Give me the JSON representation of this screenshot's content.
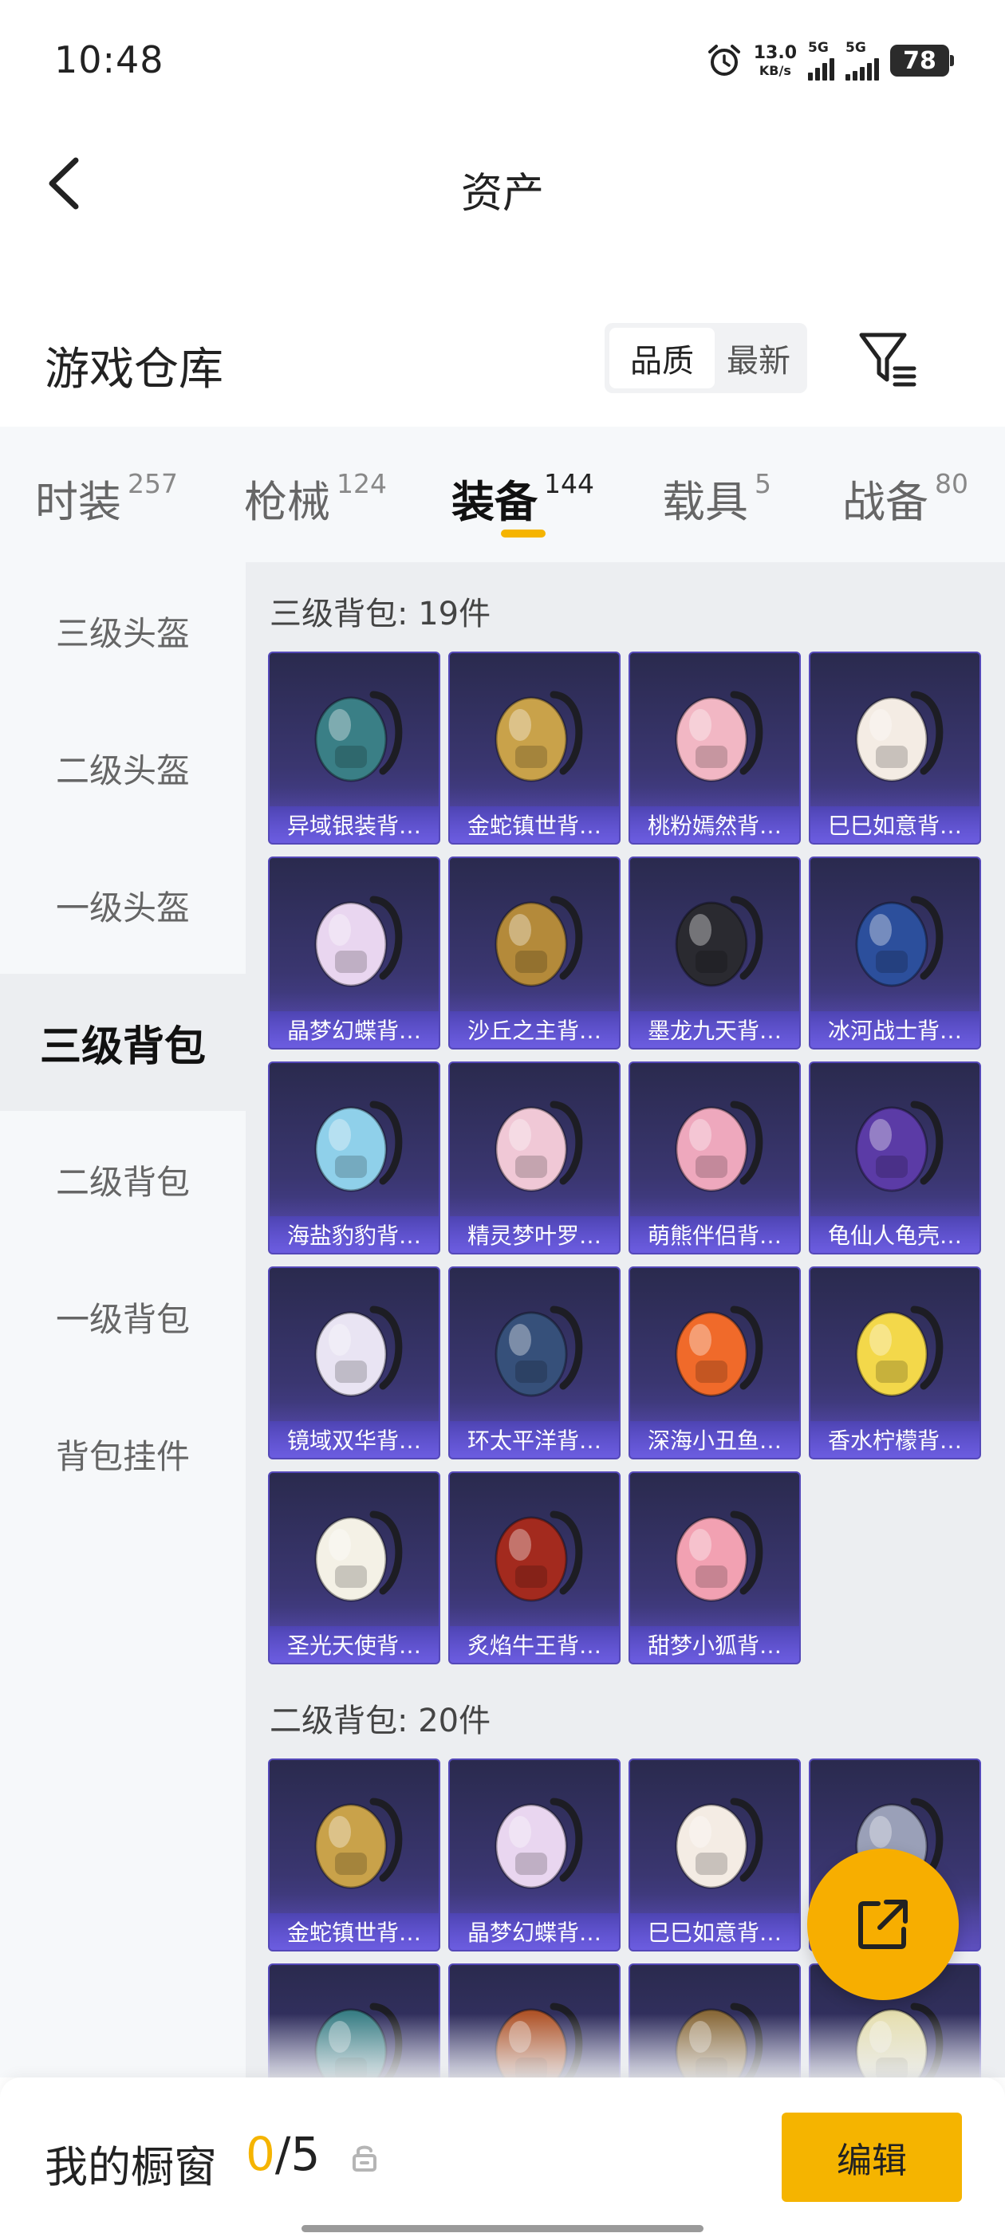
{
  "status_bar": {
    "time": "10:48",
    "net_speed_value": "13.0",
    "net_speed_unit": "KB/s",
    "sim1_type": "5G",
    "sim2_type": "5G",
    "battery": "78",
    "icons": [
      "alarm-icon",
      "signal-icon",
      "signal-icon",
      "battery-icon"
    ]
  },
  "header": {
    "title": "资产",
    "back_icon": "chevron-left-icon"
  },
  "warehouse": {
    "title": "游戏仓库",
    "sort_options": [
      "品质",
      "最新"
    ],
    "sort_selected": "品质",
    "filter_icon": "filter-icon"
  },
  "tabs": [
    {
      "label": "时装",
      "count": "257"
    },
    {
      "label": "枪械",
      "count": "124"
    },
    {
      "label": "装备",
      "count": "144"
    },
    {
      "label": "载具",
      "count": "5"
    },
    {
      "label": "战备",
      "count": "80"
    }
  ],
  "active_tab": "装备",
  "sidebar": {
    "items": [
      "三级头盔",
      "二级头盔",
      "一级头盔",
      "三级背包",
      "二级背包",
      "一级背包",
      "背包挂件"
    ],
    "active": "三级背包"
  },
  "sections": [
    {
      "title": "三级背包: 19件",
      "items": [
        {
          "name": "异域银装背…",
          "color": "#3a7f86"
        },
        {
          "name": "金蛇镇世背…",
          "color": "#c9a24a"
        },
        {
          "name": "桃粉嫣然背…",
          "color": "#f2b7c4"
        },
        {
          "name": "巳巳如意背…",
          "color": "#f4ece4"
        },
        {
          "name": "晶梦幻蝶背…",
          "color": "#e9d6f0"
        },
        {
          "name": "沙丘之主背…",
          "color": "#b48a3a"
        },
        {
          "name": "墨龙九天背…",
          "color": "#2a2a30"
        },
        {
          "name": "冰河战士背…",
          "color": "#2c4f9c"
        },
        {
          "name": "海盐豹豹背…",
          "color": "#8fd0ea"
        },
        {
          "name": "精灵梦叶罗…",
          "color": "#f0c8d6"
        },
        {
          "name": "萌熊伴侣背…",
          "color": "#eea8bd"
        },
        {
          "name": "龟仙人龟壳…",
          "color": "#5b3ba6"
        },
        {
          "name": "镜域双华背…",
          "color": "#e9e4f3"
        },
        {
          "name": "环太平洋背…",
          "color": "#36507a"
        },
        {
          "name": "深海小丑鱼…",
          "color": "#f06a2a"
        },
        {
          "name": "香水柠檬背…",
          "color": "#f3d84a"
        },
        {
          "name": "圣光天使背…",
          "color": "#f4f1e6"
        },
        {
          "name": "炙焰牛王背…",
          "color": "#a32a1e"
        },
        {
          "name": "甜梦小狐背…",
          "color": "#f2a1b2"
        }
      ]
    },
    {
      "title": "二级背包: 20件",
      "items": [
        {
          "name": "金蛇镇世背…",
          "color": "#c9a24a"
        },
        {
          "name": "晶梦幻蝶背…",
          "color": "#e9d6f0"
        },
        {
          "name": "巳巳如意背…",
          "color": "#f4ece4"
        },
        {
          "name": "",
          "color": "#9aa0b8"
        },
        {
          "name": "",
          "color": "#3a7f86"
        },
        {
          "name": "",
          "color": "#b0552a"
        },
        {
          "name": "",
          "color": "#8a6a3a"
        },
        {
          "name": "",
          "color": "#e6dfb0"
        }
      ]
    }
  ],
  "fab": {
    "icon": "share-external-icon"
  },
  "bottom_bar": {
    "label": "我的橱窗",
    "current": "0",
    "separator": "/",
    "total": "5",
    "lock_icon": "lock-icon",
    "edit_label": "编辑"
  },
  "colors": {
    "accent": "#f5b400",
    "card_bg": "#3a3670",
    "card_border": "#5448b8"
  }
}
